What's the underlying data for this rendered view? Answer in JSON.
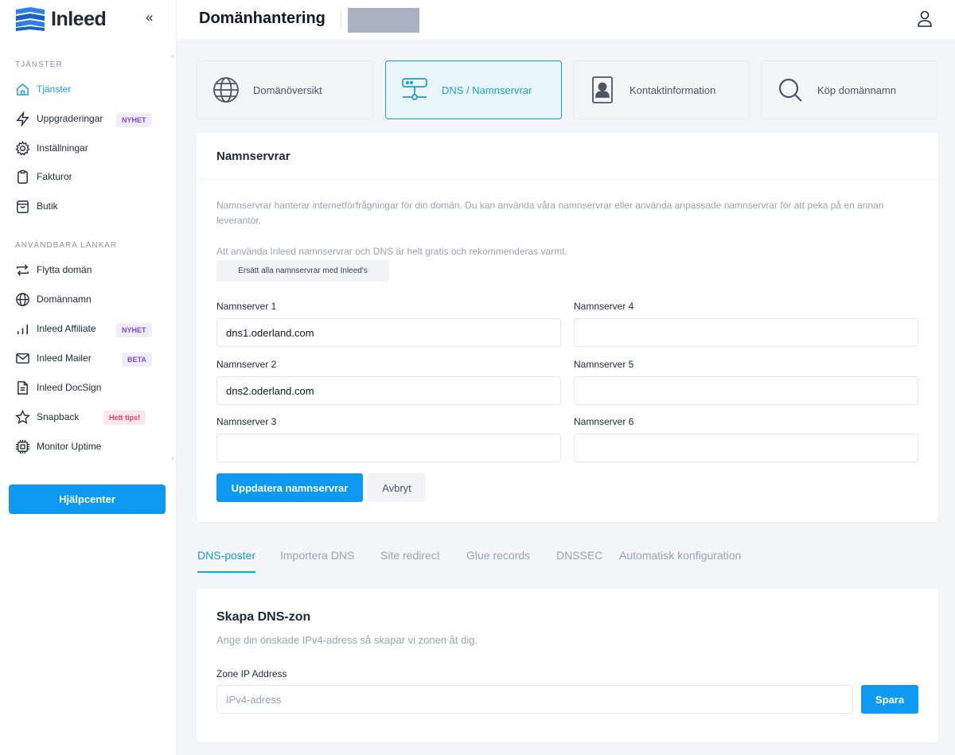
{
  "brand": {
    "name": "Inleed",
    "collapse_glyph": "«",
    "accent": "#0d99f2"
  },
  "sidebar": {
    "section_services": "TJÄNSTER",
    "section_links": "ANVÄNDBARA LÄNKAR",
    "items": [
      {
        "label": "Tjänster",
        "icon": "home-icon",
        "active": true
      },
      {
        "label": "Uppgraderingar",
        "icon": "bolt-icon",
        "badge": "NYHET"
      },
      {
        "label": "Inställningar",
        "icon": "gear-icon"
      },
      {
        "label": "Fakturor",
        "icon": "clipboard-icon"
      },
      {
        "label": "Butik",
        "icon": "bag-icon"
      },
      {
        "label": "Flytta domän",
        "icon": "transfer-icon"
      },
      {
        "label": "Domännamn",
        "icon": "globe-icon"
      },
      {
        "label": "Inleed Affiliate",
        "icon": "bars-icon",
        "badge": "NYHET"
      },
      {
        "label": "Inleed Mailer",
        "icon": "mail-icon",
        "badge": "BETA"
      },
      {
        "label": "Inleed DocSign",
        "icon": "document-icon"
      },
      {
        "label": "Snapback",
        "icon": "star-icon",
        "badge": "Hett tips!"
      },
      {
        "label": "Monitor Uptime",
        "icon": "chip-icon"
      }
    ],
    "help_label": "Hjälpcenter"
  },
  "header": {
    "title": "Domänhantering"
  },
  "domain_tabs": [
    {
      "label": "Domänöversikt",
      "icon": "globe-icon"
    },
    {
      "label": "DNS / Namnservrar",
      "icon": "server-icon",
      "active": true
    },
    {
      "label": "Kontaktinformation",
      "icon": "contact-icon"
    },
    {
      "label": "Köp domännamn",
      "icon": "search-icon"
    }
  ],
  "nameservers": {
    "title": "Namnservrar",
    "desc1": "Namnservrar hanterar internetförfrågningar för din domän. Du kan använda våra namnservrar eller använda anpassade namnservrar för att peka på en annan leverantör.",
    "desc2": "Att använda Inleed namnservrar och DNS är helt gratis och rekommenderas varmt.",
    "replace_label": "Ersätt alla namnservrar med Inleed's",
    "fields": [
      {
        "label": "Namnserver 1",
        "value": "dns1.oderland.com"
      },
      {
        "label": "Namnserver 2",
        "value": "dns2.oderland.com"
      },
      {
        "label": "Namnserver 3",
        "value": ""
      },
      {
        "label": "Namnserver 4",
        "value": ""
      },
      {
        "label": "Namnserver 5",
        "value": ""
      },
      {
        "label": "Namnserver 6",
        "value": ""
      }
    ],
    "update_label": "Uppdatera namnservrar",
    "cancel_label": "Avbryt"
  },
  "dns_tabs": [
    {
      "label": "DNS-poster",
      "active": true
    },
    {
      "label": "Importera DNS"
    },
    {
      "label": "Site redirect"
    },
    {
      "label": "Glue records"
    },
    {
      "label": "DNSSEC"
    },
    {
      "label": "Automatisk konfiguration"
    }
  ],
  "zone": {
    "title": "Skapa DNS-zon",
    "desc": "Ange din önskade IPv4-adress så skapar vi zonen åt dig.",
    "field_label": "Zone IP Address",
    "placeholder": "IPv4-adress",
    "save_label": "Spara"
  }
}
